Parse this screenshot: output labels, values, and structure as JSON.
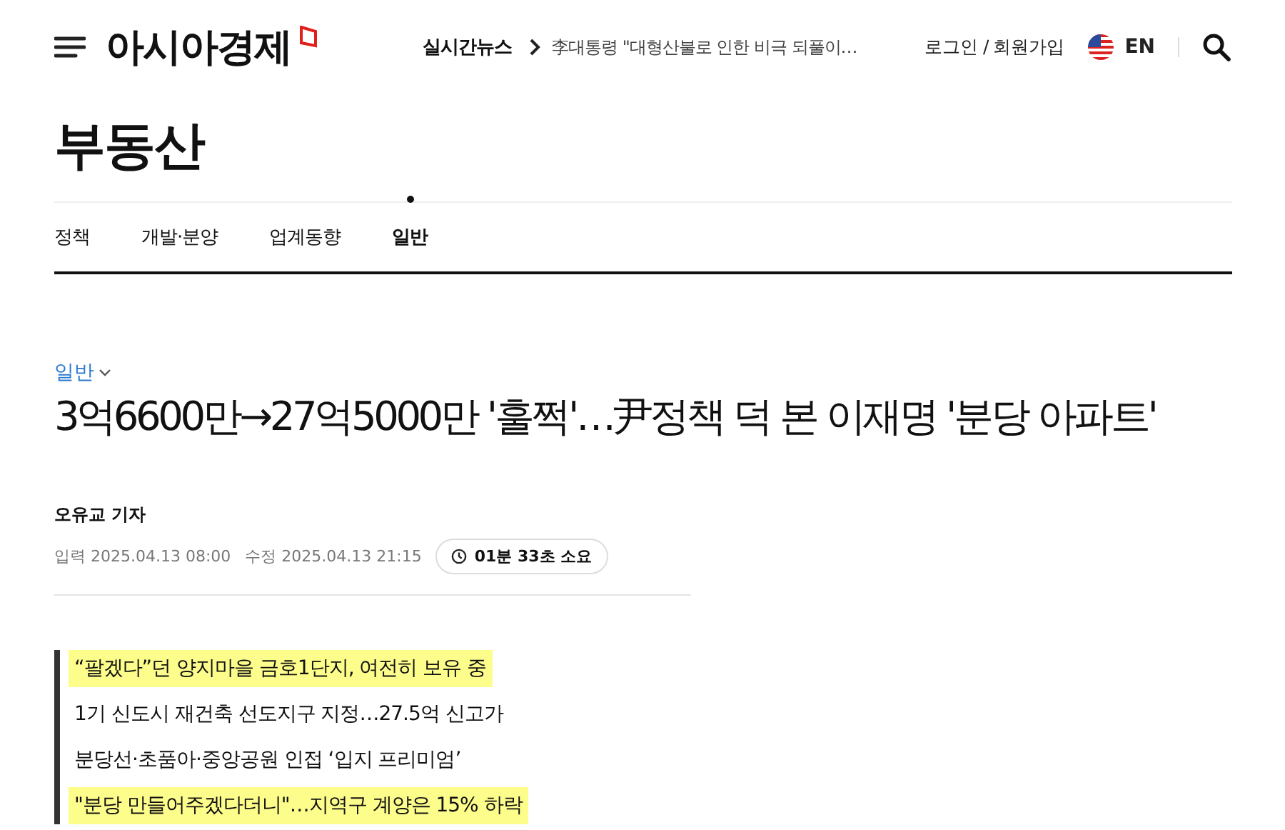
{
  "header": {
    "logo": "아시아경제",
    "live_label": "실시간뉴스",
    "live_headline": "李대통령 \"대형산불로 인한 비극 되풀이…",
    "login": "로그인 / 회원가입",
    "language": "EN"
  },
  "section": {
    "title": "부동산",
    "tabs": [
      {
        "label": "정책",
        "selected": false
      },
      {
        "label": "개발·분양",
        "selected": false
      },
      {
        "label": "업계동향",
        "selected": false
      },
      {
        "label": "일반",
        "selected": true
      }
    ]
  },
  "article": {
    "category": "일반",
    "headline": "3억6600만→27억5000만 '훌쩍'…尹정책 덕 본 이재명 '분당 아파트'",
    "author": "오유교 기자",
    "input_date": "입력 2025.04.13 08:00",
    "edit_date": "수정 2025.04.13 21:15",
    "read_time": "01분 33초 소요",
    "subheads": [
      {
        "text": "“팔겠다”던 양지마을 금호1단지, 여전히 보유 중",
        "highlighted": true
      },
      {
        "text": "1기 신도시 재건축 선도지구 지정…27.5억 신고가",
        "highlighted": false
      },
      {
        "text": "분당선·초품아·중앙공원 인접 ‘입지 프리미엄’",
        "highlighted": false
      },
      {
        "text": "\"분당 만들어주겠다더니\"…지역구 계양은 15% 하락",
        "highlighted": true
      }
    ]
  }
}
